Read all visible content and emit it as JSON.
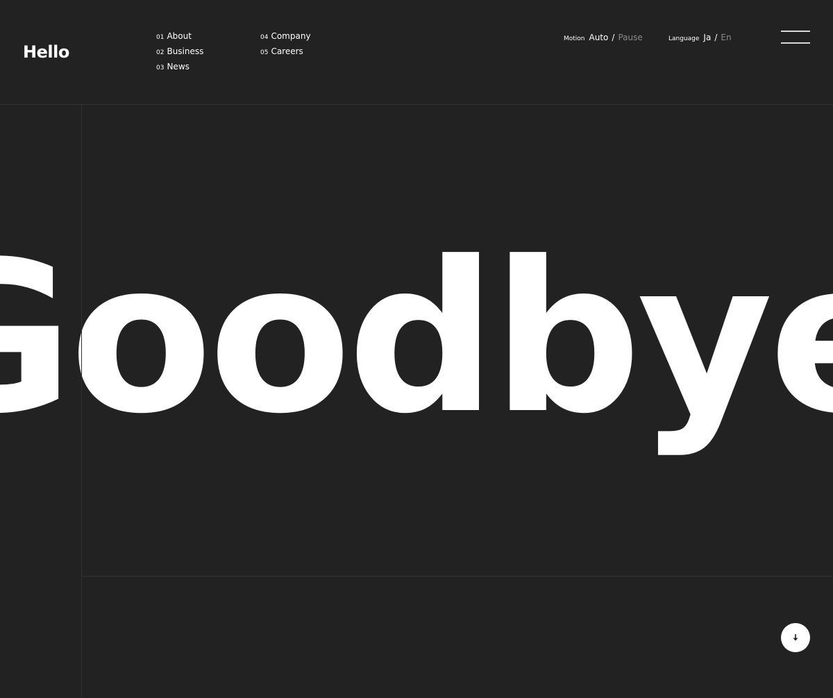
{
  "header": {
    "logo": "Hello",
    "nav": [
      {
        "num": "01",
        "label": "About"
      },
      {
        "num": "02",
        "label": "Business"
      },
      {
        "num": "03",
        "label": "News"
      },
      {
        "num": "04",
        "label": "Company"
      },
      {
        "num": "05",
        "label": "Careers"
      }
    ],
    "motion": {
      "title": "Motion",
      "active": "Auto",
      "separator": "/",
      "inactive": "Pause"
    },
    "language": {
      "title": "Language",
      "active": "Ja",
      "separator": "/",
      "inactive": "En"
    },
    "menu_icon": "hamburger-icon"
  },
  "hero": {
    "marquee_text": "Goodbye Po",
    "scroll_icon": "arrow-down-icon"
  },
  "colors": {
    "background": "#222222",
    "foreground": "#ffffff",
    "muted": "#8a8a8a",
    "divider": "#333333"
  }
}
